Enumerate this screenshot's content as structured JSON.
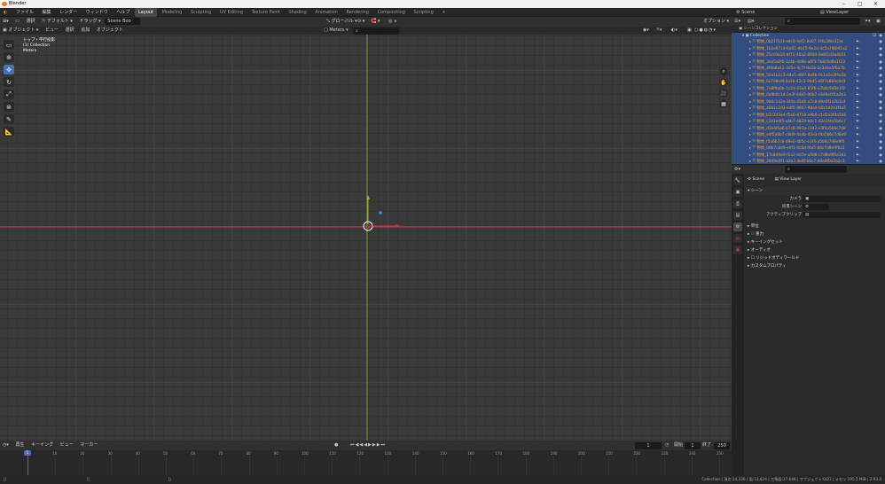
{
  "window": {
    "title": "Blender",
    "min": "–",
    "max": "□",
    "close": "✕"
  },
  "menu": [
    "ファイル",
    "編集",
    "レンダー",
    "ウィンドウ",
    "ヘルプ"
  ],
  "workspaces": [
    "Layout",
    "Modeling",
    "Sculpting",
    "UV Editing",
    "Texture Paint",
    "Shading",
    "Animation",
    "Rendering",
    "Compositing",
    "Scripting"
  ],
  "workspace_add": "+",
  "scene_name": "Scene",
  "view_layer": "ViewLayer",
  "header": {
    "mode": "オブジェクト",
    "mode2": "オブジェクトモード",
    "view": "ビュー",
    "select": "選択",
    "add": "追加",
    "object": "オブジェクト",
    "transform": "グローバル",
    "snap": "",
    "pivot": "",
    "options": "オプション",
    "left1": "選択",
    "left2": "デフォルト",
    "left3": "ドラッグ",
    "left4": "Scale",
    "scene_field": "Scene Boo"
  },
  "overlay": {
    "line1": "トップ・平行投影",
    "line2": "(1) Collection",
    "line3": "Meters"
  },
  "gizmo": {
    "x": "X",
    "y": "Y",
    "z": "Z"
  },
  "timeline": {
    "menu": [
      "再生",
      "キーイング",
      "ビュー",
      "マーカー"
    ],
    "frame": "1",
    "start_label": "開始",
    "start": "1",
    "end_label": "終了",
    "end": "250",
    "ticks": [
      "0",
      "10",
      "20",
      "30",
      "40",
      "50",
      "60",
      "70",
      "80",
      "90",
      "100",
      "110",
      "120",
      "130",
      "140",
      "150",
      "160",
      "170",
      "180",
      "190",
      "200",
      "210",
      "220",
      "230",
      "240",
      "250"
    ]
  },
  "status": {
    "left": "",
    "mid": "",
    "right": "Collection | 頂点:14,336 | 面:13,824 | 三角面:27,648 | オブジェクト:0/21 | メモリ:195.5 MiB | 2.93.4"
  },
  "outliner": {
    "search": "",
    "scene_collection": "シーンコレクション",
    "collection": "Collection",
    "items": [
      "物体_0b21f1d3-a9c6-4ef2-8a07-1f4c3fbe11ac",
      "物体_1b2e87c4-6d01-4b15-9e2d-3c5a7f80d1e2",
      "物体_25cc9a10-bf71-46a2-89d4-0e6f2d3a4b51",
      "物体_3ea5d2f0-1c4b-4d9e-a6f3-7b8c9d0e1f23",
      "物体_4f6b8a12-3d5e-4c7f-9a1b-2c3d4e5f6a7b",
      "物体_50a1b2c3-d4e5-46f7-8a9b-0c1d2e3f4a5b",
      "物体_6c7d8e9f-0a1b-42c3-94d5-e6f7a8b9c0d1",
      "物体_7e8f9a0b-1c2d-43e4-85f6-a7b8c9d0e1f2",
      "物体_8a9b0c1d-2e3f-44a5-96b7-c8d9e0f1a2b3",
      "物体_9b0c1d2e-3f4a-45b6-a7c8-d9e0f1a2b3c4",
      "物体_a0b1c2d3-e4f5-4607-98a9-b0c1d2e3f4a5",
      "物体_b1c2d3e4-f5a6-4718-a9b0-c1d2e3f4a5b6",
      "物体_c2d3e4f5-a6b7-4829-b0c1-d2e3f4a5b6c7",
      "物体_d3e4f5a6-b7c8-493a-c1d2-e3f4a5b6c7d8",
      "物体_e4f5a6b7-c8d9-4a4b-d2e3-f4a5b6c7d8e9",
      "物体_f5a6b7c8-d9e0-4b5c-e3f4-a5b6c7d8e9f0",
      "物体_06b7c8d9-e0f1-4c6d-f4a5-b6c7d8e9f0a1",
      "物体_17c8d9e0-f1a2-4d7e-a5b6-c7d8e9f0a1b2",
      "物体_28d9e0f1-a2b3-4e8f-b6c7-d8e9f0a1b2c3"
    ]
  },
  "props": {
    "breadcrumb1": "Scene",
    "breadcrumb2": "View Layer",
    "section_scene": "シーン",
    "camera_label": "カメラ",
    "background_label": "背景シーン",
    "active_clip_label": "アクティブクリップ",
    "sections": [
      "単位",
      "重力",
      "キーイングセット",
      "オーディオ",
      "リジッドボディワールド",
      "カスタムプロパティ"
    ]
  },
  "colors": {
    "accent": "#4772b3",
    "selection": "#334d80",
    "x_axis": "#c23a3a",
    "y_axis": "#8ab83a",
    "z_axis": "#3a7ad0"
  }
}
